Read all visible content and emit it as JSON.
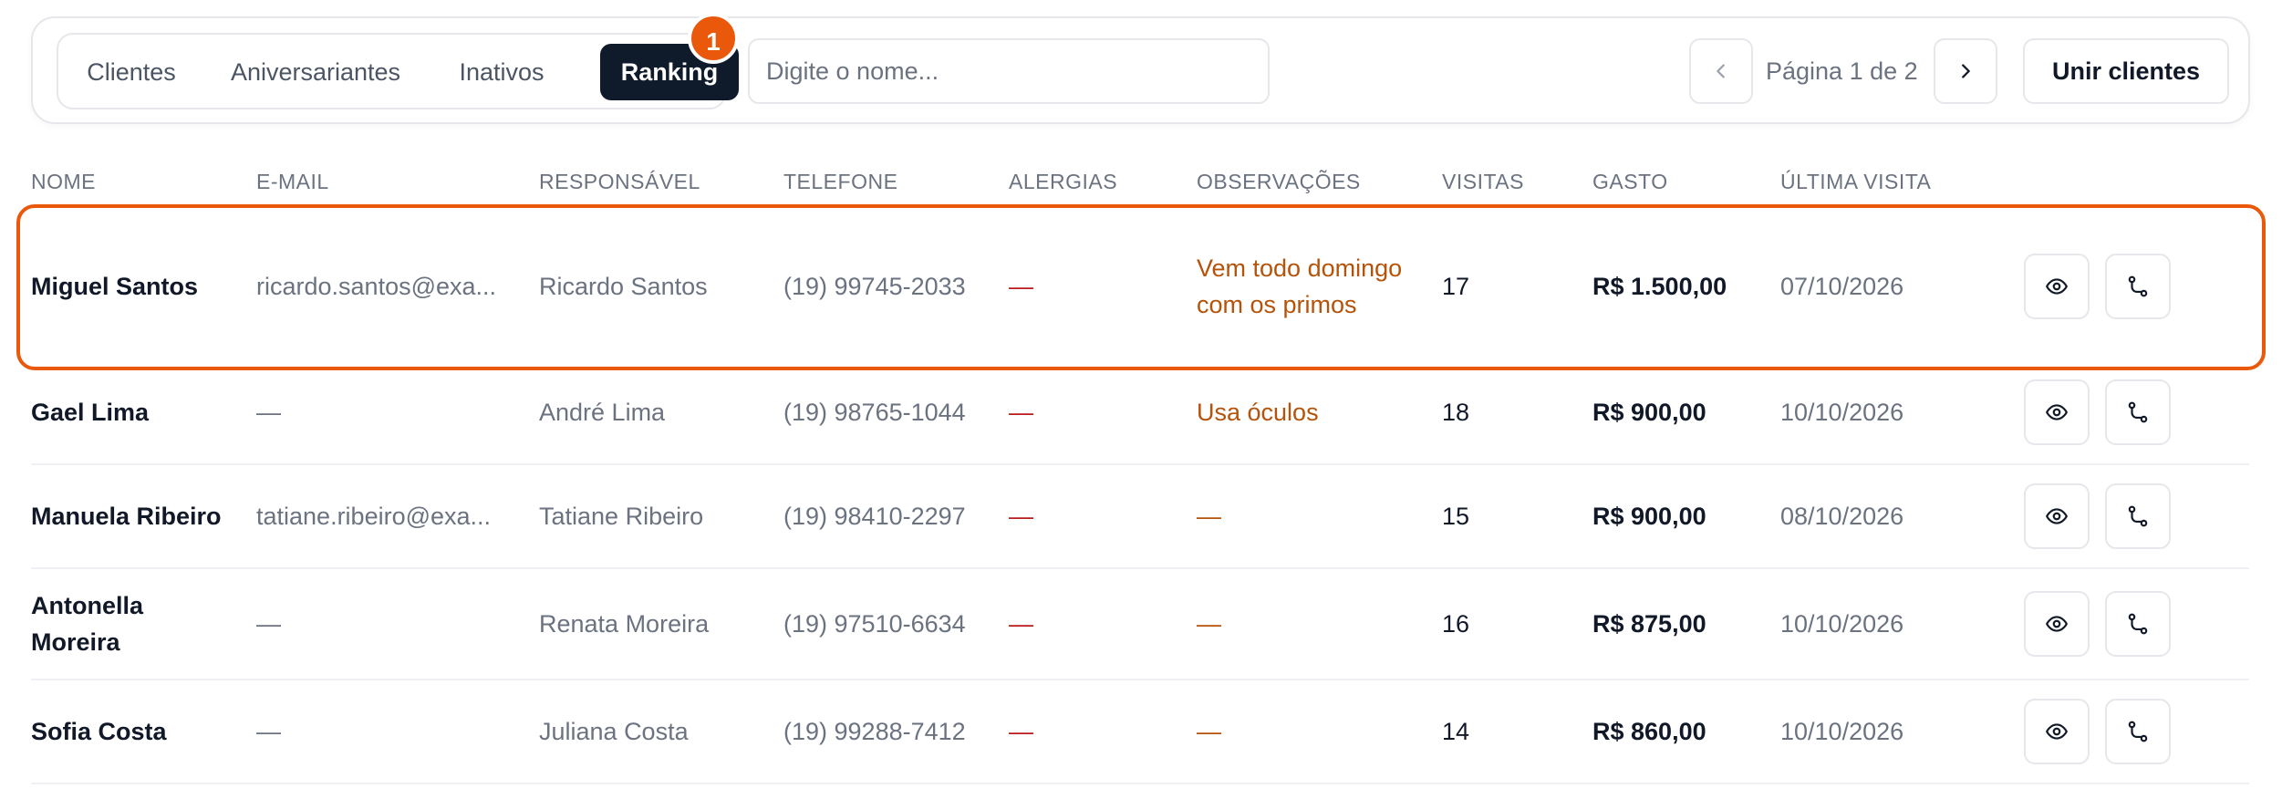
{
  "tabs": [
    {
      "label": "Clientes",
      "active": false
    },
    {
      "label": "Aniversariantes",
      "active": false
    },
    {
      "label": "Inativos",
      "active": false
    },
    {
      "label": "Ranking",
      "active": true
    }
  ],
  "badge": "1",
  "search": {
    "placeholder": "Digite o nome...",
    "value": ""
  },
  "pagination": {
    "label": "Página 1 de 2"
  },
  "merge_label": "Unir clientes",
  "columns": [
    "NOME",
    "E-MAIL",
    "RESPONSÁVEL",
    "TELEFONE",
    "ALERGIAS",
    "OBSERVAÇÕES",
    "VISITAS",
    "GASTO",
    "ÚLTIMA VISITA"
  ],
  "rows": [
    {
      "name": "Miguel Santos",
      "email": "ricardo.santos@exa...",
      "responsavel": "Ricardo Santos",
      "telefone": "(19) 99745-2033",
      "alergias": "—",
      "observacoes": "Vem todo domingo com os primos",
      "visitas": "17",
      "gasto": "R$ 1.500,00",
      "ultima": "07/10/2026"
    },
    {
      "name": "Gael Lima",
      "email": "—",
      "responsavel": "André Lima",
      "telefone": "(19) 98765-1044",
      "alergias": "—",
      "observacoes": "Usa óculos",
      "visitas": "18",
      "gasto": "R$ 900,00",
      "ultima": "10/10/2026"
    },
    {
      "name": "Manuela Ribeiro",
      "email": "tatiane.ribeiro@exa...",
      "responsavel": "Tatiane Ribeiro",
      "telefone": "(19) 98410-2297",
      "alergias": "—",
      "observacoes": "—",
      "visitas": "15",
      "gasto": "R$ 900,00",
      "ultima": "08/10/2026"
    },
    {
      "name": "Antonella Moreira",
      "email": "—",
      "responsavel": "Renata Moreira",
      "telefone": "(19) 97510-6634",
      "alergias": "—",
      "observacoes": "—",
      "visitas": "16",
      "gasto": "R$ 875,00",
      "ultima": "10/10/2026"
    },
    {
      "name": "Sofia Costa",
      "email": "—",
      "responsavel": "Juliana Costa",
      "telefone": "(19) 99288-7412",
      "alergias": "—",
      "observacoes": "—",
      "visitas": "14",
      "gasto": "R$ 860,00",
      "ultima": "10/10/2026"
    }
  ],
  "icons": {
    "prev": "chevron-left-icon",
    "next": "chevron-right-icon",
    "view": "eye-icon",
    "merge": "route-icon"
  },
  "colors": {
    "accent": "#ea580c",
    "active_tab": "#0f1a2b",
    "observation": "#b45309",
    "allergy": "#b91c1c"
  }
}
